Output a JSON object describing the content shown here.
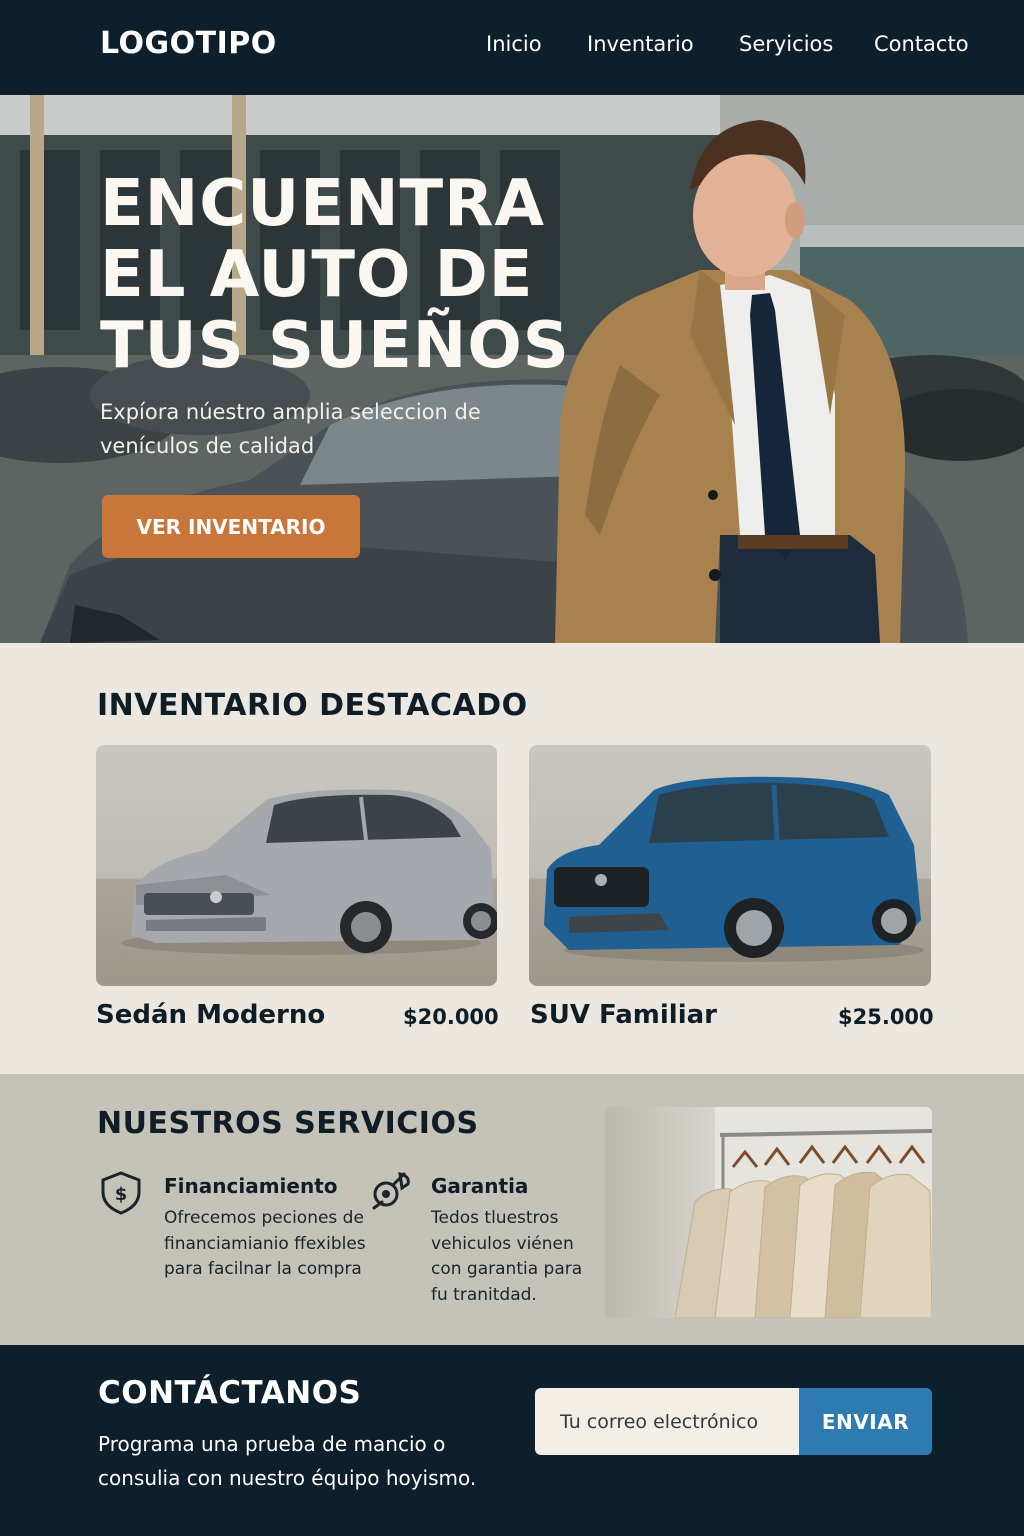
{
  "header": {
    "logo": "LOGOTIPO",
    "nav": [
      {
        "label": "Inicio"
      },
      {
        "label": "Inventario"
      },
      {
        "label": "Seryicios"
      },
      {
        "label": "Contacto"
      }
    ]
  },
  "hero": {
    "title_lines": [
      "ENCUENTRA",
      "EL AUTO DE",
      "TUS SUEÑOS"
    ],
    "subtitle": "Expíora núestro amplia seleccion de venículos de calidad",
    "cta_label": "VER INVENTARIO"
  },
  "inventory": {
    "title": "INVENTARIO DESTACADO",
    "cards": [
      {
        "name": "Sedán Moderno",
        "price": "$20.000",
        "color": "#9ea3a7"
      },
      {
        "name": "SUV Familiar",
        "price": "$25.000",
        "color": "#1f5f91"
      }
    ]
  },
  "services": {
    "title": "NUESTROS SERVICIOS",
    "items": [
      {
        "icon": "shield-dollar-icon",
        "title": "Financiamiento",
        "text": "Ofrecemos peciones de financiamianio ffexibles para facilnar la compra"
      },
      {
        "icon": "wrench-gear-icon",
        "title": "Garantia",
        "text": "Tedos tluestros vehiculos viénen con garantia para fu tranitdad."
      }
    ]
  },
  "contact": {
    "title": "CONTÁCTANOS",
    "text": "Programa una prueba de mancio o consulia con nuestro équipo hoyismo.",
    "email_placeholder": "Tu correo electrónico",
    "send_label": "ENVIAR"
  },
  "colors": {
    "navy": "#0d1f2b",
    "accent": "#c8763a",
    "button_blue": "#2d7bb0",
    "cream": "#ece8e0",
    "services_bg": "#c5c3b8"
  }
}
